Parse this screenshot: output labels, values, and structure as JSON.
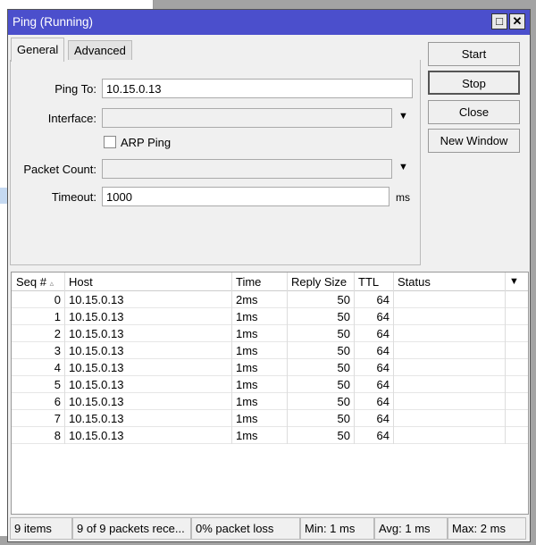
{
  "window": {
    "title": "Ping (Running)",
    "maximize_icon": "□",
    "close_icon": "✕"
  },
  "tabs": [
    {
      "label": "General"
    },
    {
      "label": "Advanced"
    }
  ],
  "form": {
    "ping_to_label": "Ping To:",
    "ping_to_value": "10.15.0.13",
    "interface_label": "Interface:",
    "interface_value": "",
    "arp_ping_label": "ARP Ping",
    "arp_ping_checked": false,
    "packet_count_label": "Packet Count:",
    "packet_count_value": "",
    "timeout_label": "Timeout:",
    "timeout_value": "1000",
    "timeout_unit": "ms"
  },
  "buttons": {
    "start": "Start",
    "stop": "Stop",
    "close": "Close",
    "new_window": "New Window"
  },
  "table": {
    "columns": [
      "Seq #",
      "Host",
      "Time",
      "Reply Size",
      "TTL",
      "Status"
    ],
    "sort_indicator": "▵",
    "rows": [
      [
        "0",
        "10.15.0.13",
        "2ms",
        "50",
        "64",
        ""
      ],
      [
        "1",
        "10.15.0.13",
        "1ms",
        "50",
        "64",
        ""
      ],
      [
        "2",
        "10.15.0.13",
        "1ms",
        "50",
        "64",
        ""
      ],
      [
        "3",
        "10.15.0.13",
        "1ms",
        "50",
        "64",
        ""
      ],
      [
        "4",
        "10.15.0.13",
        "1ms",
        "50",
        "64",
        ""
      ],
      [
        "5",
        "10.15.0.13",
        "1ms",
        "50",
        "64",
        ""
      ],
      [
        "6",
        "10.15.0.13",
        "1ms",
        "50",
        "64",
        ""
      ],
      [
        "7",
        "10.15.0.13",
        "1ms",
        "50",
        "64",
        ""
      ],
      [
        "8",
        "10.15.0.13",
        "1ms",
        "50",
        "64",
        ""
      ]
    ]
  },
  "statusbar": [
    "9 items",
    "9 of 9 packets rece...",
    "0% packet loss",
    "Min: 1 ms",
    "Avg: 1 ms",
    "Max: 2 ms"
  ],
  "colors": {
    "titlebar": "#4b4fcc"
  }
}
